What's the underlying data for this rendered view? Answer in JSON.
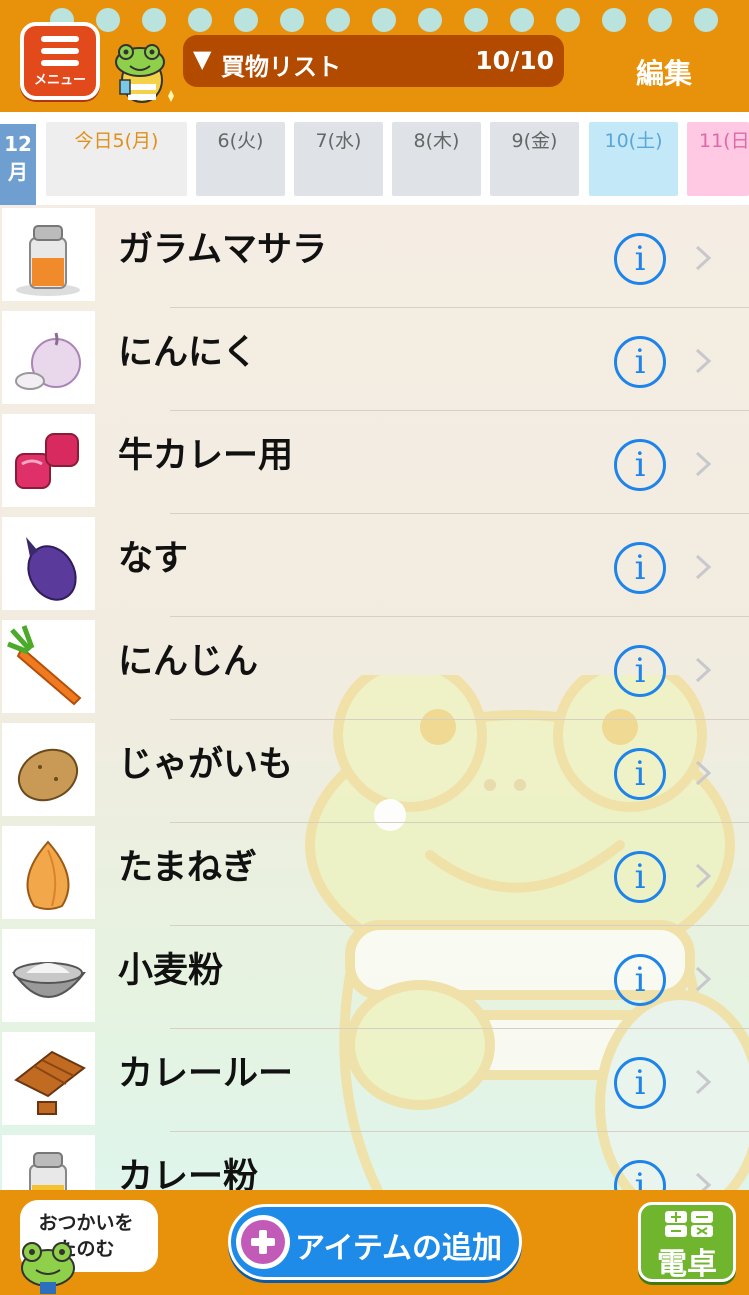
{
  "header": {
    "menu_label": "メニュー",
    "list_indicator": "▼",
    "list_title": "買物リスト",
    "list_count": "10/10",
    "edit_label": "編集"
  },
  "datebar": {
    "month": "12\n月",
    "days": [
      {
        "label": "今日5(月)",
        "kind": "today"
      },
      {
        "label": "6(火)",
        "kind": "weekday"
      },
      {
        "label": "7(水)",
        "kind": "weekday"
      },
      {
        "label": "8(木)",
        "kind": "weekday"
      },
      {
        "label": "9(金)",
        "kind": "weekday"
      },
      {
        "label": "10(土)",
        "kind": "sat"
      },
      {
        "label": "11(日",
        "kind": "sun"
      }
    ]
  },
  "items": [
    {
      "name": "ガラムマサラ",
      "icon": "spice-jar-orange-icon"
    },
    {
      "name": "にんにく",
      "icon": "garlic-icon"
    },
    {
      "name": "牛カレー用",
      "icon": "beef-cubes-icon"
    },
    {
      "name": "なす",
      "icon": "eggplant-icon"
    },
    {
      "name": "にんじん",
      "icon": "carrot-icon"
    },
    {
      "name": "じゃがいも",
      "icon": "potato-icon"
    },
    {
      "name": "たまねぎ",
      "icon": "onion-icon"
    },
    {
      "name": "小麦粉",
      "icon": "flour-bowl-icon"
    },
    {
      "name": "カレールー",
      "icon": "curry-roux-icon"
    },
    {
      "name": "カレー粉",
      "icon": "spice-jar-yellow-icon"
    }
  ],
  "row_controls": {
    "info_glyph": "i"
  },
  "footer": {
    "ask_label": "おつかいを\nたのむ",
    "add_label": "アイテムの追加",
    "calc_label": "電卓"
  },
  "colors": {
    "header_bg": "#e8920c",
    "pill_bg": "#b24a00",
    "info_blue": "#1f84ea",
    "add_button": "#1f8be8",
    "calc_button": "#6fb52d"
  }
}
